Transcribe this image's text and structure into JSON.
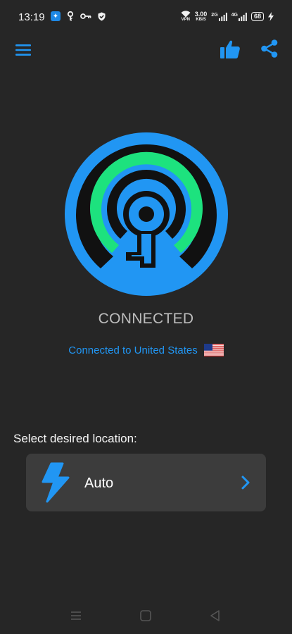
{
  "status_bar": {
    "time": "13:19",
    "net_speed_value": "3.00",
    "net_speed_unit": "KB/S",
    "vpn_label": "VPN",
    "sim1_label": "2G",
    "sim2_label": "4G",
    "battery": "68",
    "icons_left": [
      "shield-app-icon",
      "key-icon",
      "vpn-key-icon",
      "shield-check-icon"
    ]
  },
  "header": {
    "menu_icon": "hamburger-menu-icon",
    "like_icon": "thumbs-up-icon",
    "share_icon": "share-icon"
  },
  "connection": {
    "status": "CONNECTED",
    "detail": "Connected to United States",
    "flag": "us-flag-icon"
  },
  "location": {
    "prompt": "Select desired location:",
    "selected": "Auto",
    "icon": "lightning-bolt-icon"
  },
  "colors": {
    "background": "#262626",
    "accent_blue": "#2196f3",
    "accent_green": "#1de27e",
    "card": "#3c3c3c",
    "status_gray": "#bdbdbd"
  }
}
